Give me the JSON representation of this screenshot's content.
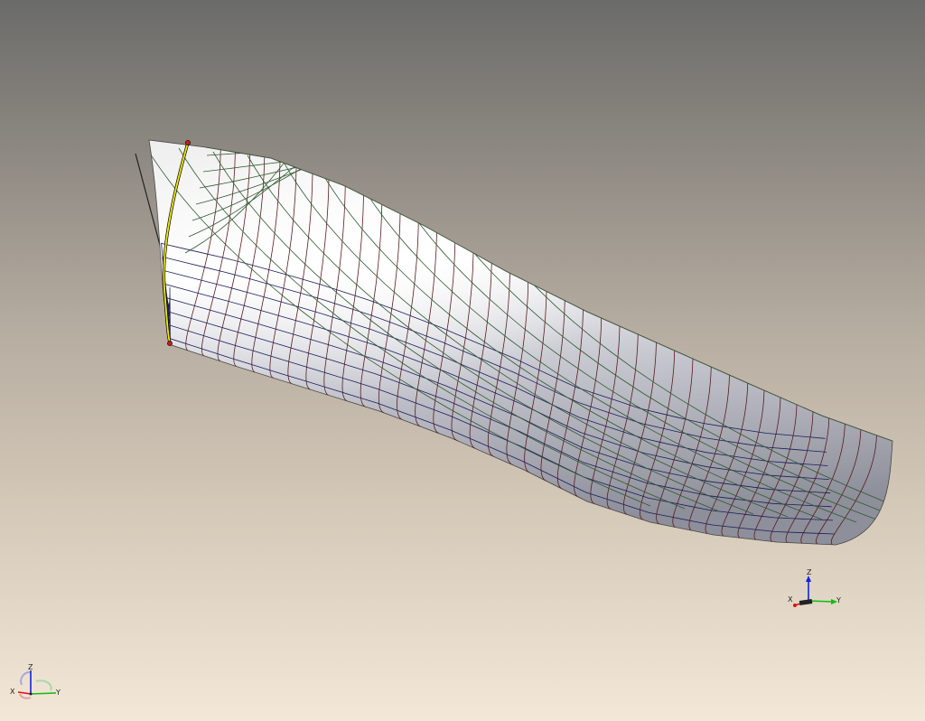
{
  "viewport": {
    "background_top": "#6b6b69",
    "background_bottom": "#f3e8d8"
  },
  "model": {
    "hull_fill_light": "#ffffff",
    "hull_fill_dark": "#8d8f9a",
    "station_color": "#5a1b1b",
    "waterline_color": "#1c1c5a",
    "diagonal_color": "#2f5a2f",
    "selected_curve_color": "#f2e90f",
    "selected_endpoint_color": "#cc1a1a"
  },
  "triad_view": {
    "x_label": "X",
    "y_label": "Y",
    "z_label": "Z",
    "x_color": "#dd1111",
    "y_color": "#11bb11",
    "z_color": "#1122dd"
  },
  "triad_global": {
    "x_label": "X",
    "y_label": "Y",
    "z_label": "Z"
  }
}
